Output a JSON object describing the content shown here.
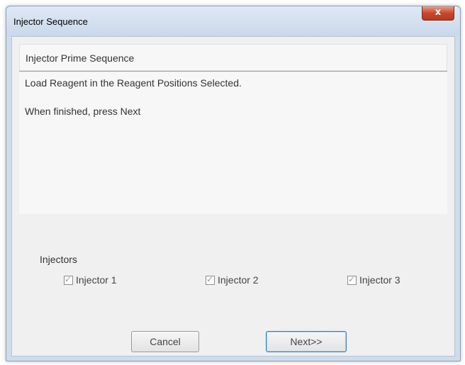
{
  "window": {
    "title": "Injector Sequence",
    "close_glyph": "x"
  },
  "sequence": {
    "header": "Injector Prime Sequence",
    "message_line_1": "Load Reagent in the Reagent Positions Selected.",
    "message_line_2": "When finished, press Next"
  },
  "injectors": {
    "label": "Injectors",
    "items": [
      {
        "label": "Injector 1",
        "checked": true
      },
      {
        "label": "Injector 2",
        "checked": true
      },
      {
        "label": "Injector 3",
        "checked": true
      }
    ]
  },
  "buttons": {
    "cancel_label": "Cancel",
    "next_label": "Next>>"
  },
  "icons": {
    "close": "close-icon",
    "check": "check-icon"
  },
  "colors": {
    "close_button": "#c9462b",
    "title_bar": "#dfe9f5",
    "default_button_border": "#3c7fb1"
  }
}
